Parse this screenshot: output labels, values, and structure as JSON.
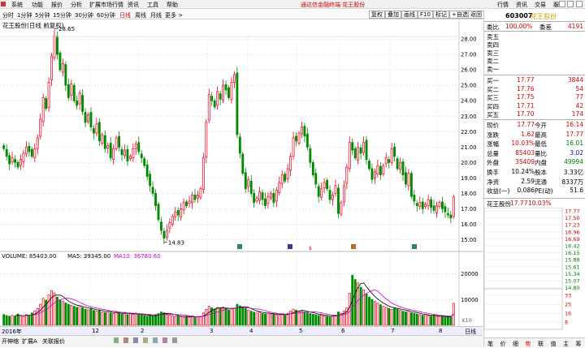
{
  "menu": {
    "items": [
      "系统",
      "功能",
      "报价",
      "分析",
      "扩展市场行情",
      "资讯",
      "工具",
      "帮助"
    ],
    "center_title": "通达信金融终端  花王股份",
    "right_items": [
      "行情",
      "资讯",
      "交易",
      "服务"
    ]
  },
  "toolbar": {
    "periods": [
      "分时",
      "1分钟",
      "5分钟",
      "15分钟",
      "30分钟",
      "60分钟",
      "日线",
      "周线",
      "月线",
      "更多 >"
    ],
    "active_period": "日线",
    "right_buttons": [
      "复权",
      "叠加",
      "画线",
      "F10",
      "标记",
      "+自选",
      "返回"
    ]
  },
  "chart": {
    "header": "花王股份(日线 前复权)",
    "price_axis_ticks": [
      "28.00",
      "27.00",
      "26.00",
      "25.00",
      "24.00",
      "23.00",
      "22.00",
      "21.00",
      "20.00",
      "19.00",
      "18.00",
      "17.00",
      "16.00",
      "15.00"
    ],
    "max_label": "28.65",
    "min_label": "14.83",
    "volume_header_vol": "VOLUME: 85403.00",
    "volume_header_ma5": "MA5: 39345.00",
    "volume_header_ma10": "MA10: 36780.60",
    "volume_axis_ticks": [
      "20000",
      "10000"
    ],
    "volume_unit": "X10",
    "date_labels": [
      "2016年",
      "12",
      "2",
      "3",
      "4",
      "5",
      "6",
      "7",
      "8"
    ],
    "period_tag": "日线"
  },
  "bottom": {
    "tabs": [
      "开伸缩",
      "扩展A",
      "关联报价"
    ]
  },
  "panel": {
    "code": "603007",
    "name": "花王股份",
    "weibi_label": "委比",
    "weibi_value": "100.00%",
    "weicha_label": "委差",
    "weicha_value": "4191",
    "sell": [
      "卖五",
      "卖四",
      "卖三",
      "卖二",
      "卖一"
    ],
    "buy": [
      {
        "label": "买一",
        "price": "17.77",
        "vol": "3844"
      },
      {
        "label": "买二",
        "price": "17.76",
        "vol": "54"
      },
      {
        "label": "买三",
        "price": "17.75",
        "vol": "77"
      },
      {
        "label": "买四",
        "price": "17.71",
        "vol": "42"
      },
      {
        "label": "买五",
        "price": "17.70",
        "vol": "174"
      }
    ],
    "stats": [
      {
        "l": "现价",
        "v": "17.77",
        "l2": "今开",
        "v2": "16.14"
      },
      {
        "l": "涨跌",
        "v": "1.62",
        "l2": "最高",
        "v2": "17.77"
      },
      {
        "l": "涨幅",
        "v": "10.03%",
        "l2": "最低",
        "v2": "16.01"
      },
      {
        "l": "总量",
        "v": "85403",
        "l2": "量比",
        "v2": "3.02"
      },
      {
        "l": "外盘",
        "v": "35409",
        "l2": "内盘",
        "v2": "49994"
      },
      {
        "l": "换手",
        "v": "10.24%",
        "l2": "股本",
        "v2": "3.33亿"
      },
      {
        "l": "净资",
        "v": "2.59",
        "l2": "流通",
        "v2": "8337万"
      },
      {
        "l": "收益(一)",
        "v": "0.086",
        "l2": "PE(动)",
        "v2": "51.6"
      }
    ],
    "mini_title": "花王股份",
    "mini_price": "17.77",
    "mini_pct": "10.03%",
    "mini_ticks": [
      "17.77",
      "17.50",
      "17.23",
      "16.96",
      "16.69",
      "16.42",
      "16.15",
      "15.88",
      "15.61",
      "15.34",
      "15.07",
      "14.80",
      "33",
      "25",
      "16",
      "8"
    ],
    "bottom_tabs": [
      "笔",
      "价",
      "细",
      "势",
      "联",
      "值",
      "主",
      "筹"
    ]
  },
  "colors": {
    "up": "#e8001c",
    "down": "#008a00",
    "ma5": "#000000",
    "ma10": "#cc00cc"
  },
  "chart_data": {
    "type": "candlestick",
    "price_range": [
      14.5,
      28.9
    ],
    "closes": [
      20.9,
      20.4,
      19.9,
      20.3,
      20.0,
      19.7,
      20.2,
      20.6,
      21.0,
      20.7,
      20.4,
      20.9,
      21.6,
      22.8,
      24.2,
      23.5,
      25.2,
      26.9,
      28.2,
      27.0,
      26.0,
      26.4,
      25.0,
      24.2,
      25.1,
      24.0,
      23.7,
      24.5,
      23.3,
      22.6,
      23.1,
      22.3,
      21.9,
      22.5,
      21.4,
      21.8,
      20.9,
      21.1,
      20.3,
      20.9,
      21.6,
      21.0,
      20.5,
      20.8,
      20.1,
      20.4,
      20.9,
      21.2,
      20.7,
      20.3,
      19.8,
      19.1,
      18.5,
      18.0,
      17.2,
      16.3,
      15.6,
      15.1,
      15.6,
      16.1,
      16.5,
      16.8,
      16.6,
      17.0,
      17.4,
      17.2,
      17.5,
      17.9,
      17.6,
      17.9,
      18.3,
      20.3,
      22.6,
      24.4,
      24.0,
      23.6,
      24.6,
      24.1,
      25.0,
      24.7,
      24.2,
      25.2,
      25.7,
      21.8,
      20.6,
      19.3,
      18.3,
      18.9,
      18.0,
      17.4,
      17.7,
      18.1,
      17.6,
      17.2,
      17.8,
      18.0,
      17.4,
      18.2,
      18.7,
      19.2,
      18.8,
      19.6,
      20.4,
      21.6,
      21.4,
      21.9,
      22.3,
      21.7,
      21.0,
      20.0,
      19.2,
      18.6,
      17.8,
      18.3,
      18.7,
      18.3,
      17.6,
      17.9,
      18.5,
      16.7,
      17.4,
      18.5,
      19.7,
      21.3,
      20.8,
      20.3,
      21.0,
      20.6,
      21.3,
      20.2,
      19.6,
      18.9,
      19.4,
      19.8,
      19.2,
      19.8,
      20.3,
      20.0,
      20.9,
      20.4,
      19.6,
      20.0,
      19.2,
      18.6,
      19.3,
      17.8,
      17.5,
      17.2,
      17.4,
      17.0,
      17.3,
      17.6,
      17.1,
      16.9,
      17.2,
      17.4,
      17.0,
      16.8,
      16.6,
      16.4,
      17.77
    ],
    "volumes": [
      4200,
      3800,
      3500,
      3900,
      3600,
      4400,
      3700,
      3400,
      4100,
      3900,
      4800,
      5600,
      6500,
      8200,
      10500,
      9800,
      11800,
      13500,
      12600,
      11000,
      9800,
      9400,
      8700,
      8200,
      7800,
      7400,
      7000,
      7600,
      6900,
      6300,
      6000,
      6600,
      5800,
      5500,
      5900,
      5200,
      5000,
      5400,
      4800,
      4600,
      5100,
      4700,
      4400,
      4900,
      4200,
      4500,
      4300,
      4700,
      4100,
      4000,
      3800,
      3600,
      3900,
      3500,
      4200,
      4600,
      5200,
      4900,
      4400,
      3900,
      3600,
      3400,
      3800,
      3300,
      3100,
      3500,
      3200,
      3600,
      3000,
      3300,
      3500,
      4800,
      6200,
      7400,
      6800,
      6300,
      6900,
      6500,
      7100,
      6600,
      6000,
      6400,
      6700,
      8200,
      7600,
      7000,
      6500,
      5900,
      5500,
      5100,
      4800,
      5200,
      4600,
      4400,
      4800,
      4200,
      4500,
      4100,
      3900,
      4300,
      3800,
      4700,
      5500,
      6300,
      5900,
      5400,
      5800,
      5200,
      4900,
      4600,
      4300,
      4100,
      3800,
      4000,
      3700,
      3500,
      3300,
      3600,
      3900,
      5200,
      4700,
      5600,
      6800,
      12500,
      19500,
      17800,
      16500,
      14800,
      13800,
      12200,
      11000,
      10100,
      9300,
      8600,
      8000,
      7400,
      7000,
      6600,
      6200,
      6800,
      6300,
      5800,
      5500,
      5200,
      5600,
      4900,
      4600,
      4400,
      4100,
      3900,
      4200,
      3800,
      3600,
      3900,
      3500,
      3300,
      3500,
      3200,
      3400,
      3100,
      8540
    ]
  }
}
